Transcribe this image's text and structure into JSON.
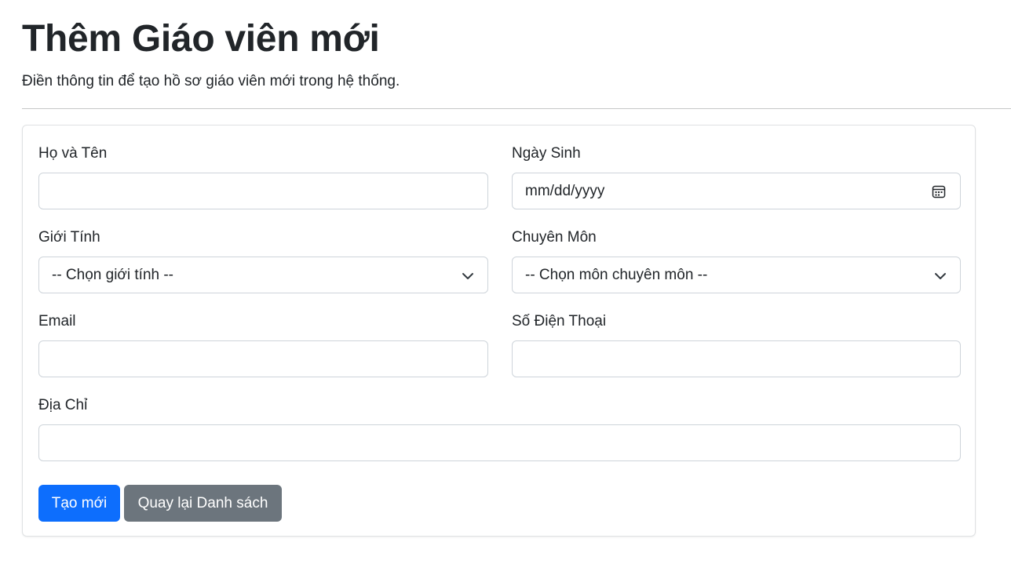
{
  "page": {
    "title": "Thêm Giáo viên mới",
    "subtitle": "Điền thông tin để tạo hồ sơ giáo viên mới trong hệ thống."
  },
  "form": {
    "full_name": {
      "label": "Họ và Tên",
      "value": ""
    },
    "birth_date": {
      "label": "Ngày Sinh",
      "display": "mm/dd/yyyy",
      "icon": "calendar-icon"
    },
    "gender": {
      "label": "Giới Tính",
      "selected": "-- Chọn giới tính --",
      "icon": "chevron-down-icon"
    },
    "subject": {
      "label": "Chuyên Môn",
      "selected": "-- Chọn môn chuyên môn --",
      "icon": "chevron-down-icon"
    },
    "email": {
      "label": "Email",
      "value": ""
    },
    "phone": {
      "label": "Số Điện Thoại",
      "value": ""
    },
    "address": {
      "label": "Địa Chỉ",
      "value": ""
    }
  },
  "actions": {
    "create_label": "Tạo mới",
    "back_label": "Quay lại Danh sách"
  },
  "colors": {
    "primary": "#0d6efd",
    "secondary": "#6c757d",
    "input_border": "#ced4da",
    "text": "#212529"
  }
}
